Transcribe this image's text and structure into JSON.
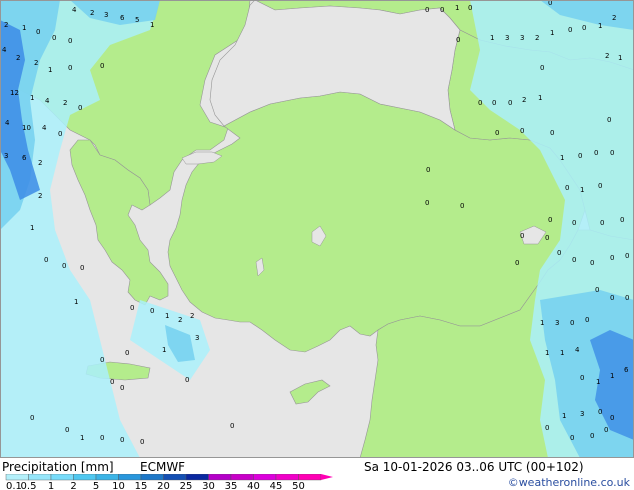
{
  "title_left": "Precipitation [mm]",
  "model": "ECMWF",
  "valid_time": "Sa 10-01-2026 03..06 UTC (00+102)",
  "credit": "©weatheronline.co.uk",
  "legend": {
    "ticks": [
      "0.1",
      "0.5",
      "1",
      "2",
      "5",
      "10",
      "15",
      "20",
      "25",
      "30",
      "35",
      "40",
      "45",
      "50"
    ],
    "colors": [
      "#b4f0fa",
      "#96e6fa",
      "#78dcfa",
      "#50c8f0",
      "#3cb4e6",
      "#2896dc",
      "#1e78c8",
      "#1450b4",
      "#0a28a0",
      "#b400c8",
      "#c800c8",
      "#dc00dc",
      "#f000c8",
      "#ff00b4"
    ]
  },
  "colors": {
    "land": "#b4ec8c",
    "sea_nodata": "#e6e6e6",
    "precip_light": "#aaf0fa",
    "precip_mid": "#78d2f0",
    "precip_heavy": "#3c8ce6",
    "border": "#969696"
  },
  "point_values": [
    {
      "v": "4"
    },
    {
      "v": "2"
    },
    {
      "v": "3"
    },
    {
      "v": "6"
    },
    {
      "v": "5"
    },
    {
      "v": "1"
    },
    {
      "v": "0"
    },
    {
      "v": "0"
    },
    {
      "v": "1"
    },
    {
      "v": "0"
    },
    {
      "v": "0"
    },
    {
      "v": "2"
    },
    {
      "v": "2"
    },
    {
      "v": "1"
    },
    {
      "v": "0"
    },
    {
      "v": "0"
    },
    {
      "v": "0"
    },
    {
      "v": "0"
    },
    {
      "v": "4"
    },
    {
      "v": "2"
    },
    {
      "v": "2"
    },
    {
      "v": "1"
    },
    {
      "v": "0"
    },
    {
      "v": "0"
    },
    {
      "v": "1"
    },
    {
      "v": "3"
    },
    {
      "v": "3"
    },
    {
      "v": "2"
    },
    {
      "v": "1"
    },
    {
      "v": "0"
    },
    {
      "v": "0"
    },
    {
      "v": "1"
    },
    {
      "v": "2"
    },
    {
      "v": "1"
    },
    {
      "v": "0"
    },
    {
      "v": "12"
    },
    {
      "v": "1"
    },
    {
      "v": "4"
    },
    {
      "v": "2"
    },
    {
      "v": "0"
    },
    {
      "v": "0"
    },
    {
      "v": "0"
    },
    {
      "v": "0"
    },
    {
      "v": "2"
    },
    {
      "v": "1"
    },
    {
      "v": "4"
    },
    {
      "v": "10"
    },
    {
      "v": "4"
    },
    {
      "v": "0"
    },
    {
      "v": "0"
    },
    {
      "v": "0"
    },
    {
      "v": "0"
    },
    {
      "v": "0"
    },
    {
      "v": "3"
    },
    {
      "v": "6"
    },
    {
      "v": "2"
    },
    {
      "v": "1"
    },
    {
      "v": "0"
    },
    {
      "v": "0"
    },
    {
      "v": "0"
    },
    {
      "v": "0"
    },
    {
      "v": "0"
    },
    {
      "v": "1"
    },
    {
      "v": "0"
    },
    {
      "v": "0"
    },
    {
      "v": "2"
    },
    {
      "v": "0"
    },
    {
      "v": "0"
    },
    {
      "v": "0"
    },
    {
      "v": "0"
    },
    {
      "v": "0"
    },
    {
      "v": "1"
    },
    {
      "v": "0"
    },
    {
      "v": "0"
    },
    {
      "v": "0"
    },
    {
      "v": "0"
    },
    {
      "v": "0"
    },
    {
      "v": "0"
    },
    {
      "v": "0"
    },
    {
      "v": "0"
    },
    {
      "v": "0"
    },
    {
      "v": "0"
    },
    {
      "v": "0"
    },
    {
      "v": "0"
    },
    {
      "v": "0"
    },
    {
      "v": "0"
    },
    {
      "v": "1"
    },
    {
      "v": "0"
    },
    {
      "v": "0"
    },
    {
      "v": "1"
    },
    {
      "v": "2"
    },
    {
      "v": "2"
    },
    {
      "v": "1"
    },
    {
      "v": "3"
    },
    {
      "v": "0"
    },
    {
      "v": "0"
    },
    {
      "v": "3"
    },
    {
      "v": "1"
    },
    {
      "v": "0"
    },
    {
      "v": "0"
    },
    {
      "v": "1"
    },
    {
      "v": "1"
    },
    {
      "v": "4"
    },
    {
      "v": "0"
    },
    {
      "v": "0"
    },
    {
      "v": "0"
    },
    {
      "v": "0"
    },
    {
      "v": "1"
    },
    {
      "v": "1"
    },
    {
      "v": "6"
    },
    {
      "v": "0"
    },
    {
      "v": "0"
    },
    {
      "v": "1"
    },
    {
      "v": "0"
    },
    {
      "v": "0"
    },
    {
      "v": "0"
    },
    {
      "v": "1"
    },
    {
      "v": "3"
    },
    {
      "v": "0"
    },
    {
      "v": "0"
    },
    {
      "v": "0"
    },
    {
      "v": "0"
    },
    {
      "v": "0"
    },
    {
      "v": "0"
    },
    {
      "v": "0"
    }
  ]
}
